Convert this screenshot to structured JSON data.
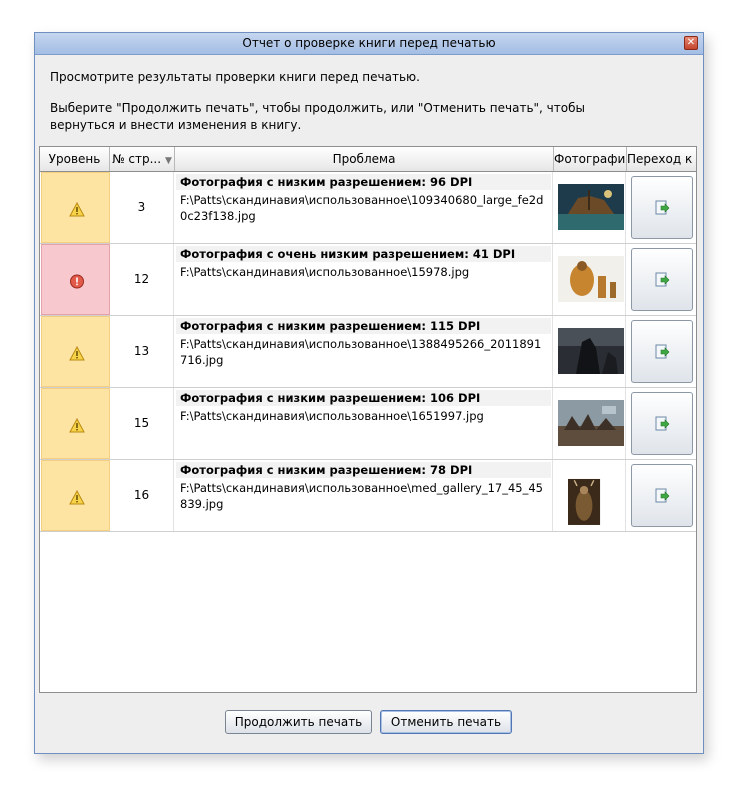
{
  "window": {
    "title": "Отчет о проверке книги перед печатью",
    "close_glyph": "✕"
  },
  "message": {
    "line1": "Просмотрите результаты проверки книги перед печатью.",
    "line2": "Выберите \"Продолжить печать\", чтобы продолжить, или \"Отменить печать\", чтобы вернуться и внести изменения в книгу."
  },
  "table": {
    "headers": {
      "level": "Уровень",
      "page": "№ стр...",
      "problem": "Проблема",
      "photo": "Фотография",
      "goto": "Переход к ..."
    },
    "rows": [
      {
        "level": "warning",
        "page": "3",
        "title": "Фотография с низким разрешением: 96 DPI",
        "path": "F:\\Patts\\скандинавия\\использованное\\109340680_large_fe2d0c23f138.jpg"
      },
      {
        "level": "error",
        "page": "12",
        "title": "Фотография с очень низким разрешением: 41 DPI",
        "path": "F:\\Patts\\скандинавия\\использованное\\15978.jpg"
      },
      {
        "level": "warning",
        "page": "13",
        "title": "Фотография с низким разрешением: 115 DPI",
        "path": "F:\\Patts\\скандинавия\\использованное\\1388495266_2011891716.jpg"
      },
      {
        "level": "warning",
        "page": "15",
        "title": "Фотография с низким разрешением: 106 DPI",
        "path": "F:\\Patts\\скандинавия\\использованное\\1651997.jpg"
      },
      {
        "level": "warning",
        "page": "16",
        "title": "Фотография с низким разрешением: 78 DPI",
        "path": "F:\\Patts\\скандинавия\\использованное\\med_gallery_17_45_45839.jpg"
      }
    ]
  },
  "buttons": {
    "continue": "Продолжить печать",
    "cancel": "Отменить печать"
  },
  "colors": {
    "warning_bg": "#fde4a3",
    "error_bg": "#f7c9cf",
    "titlebar": "#b7cbea"
  },
  "icons": {
    "warning": "warning-triangle-icon",
    "error": "error-circle-icon",
    "goto": "go-to-page-icon"
  }
}
